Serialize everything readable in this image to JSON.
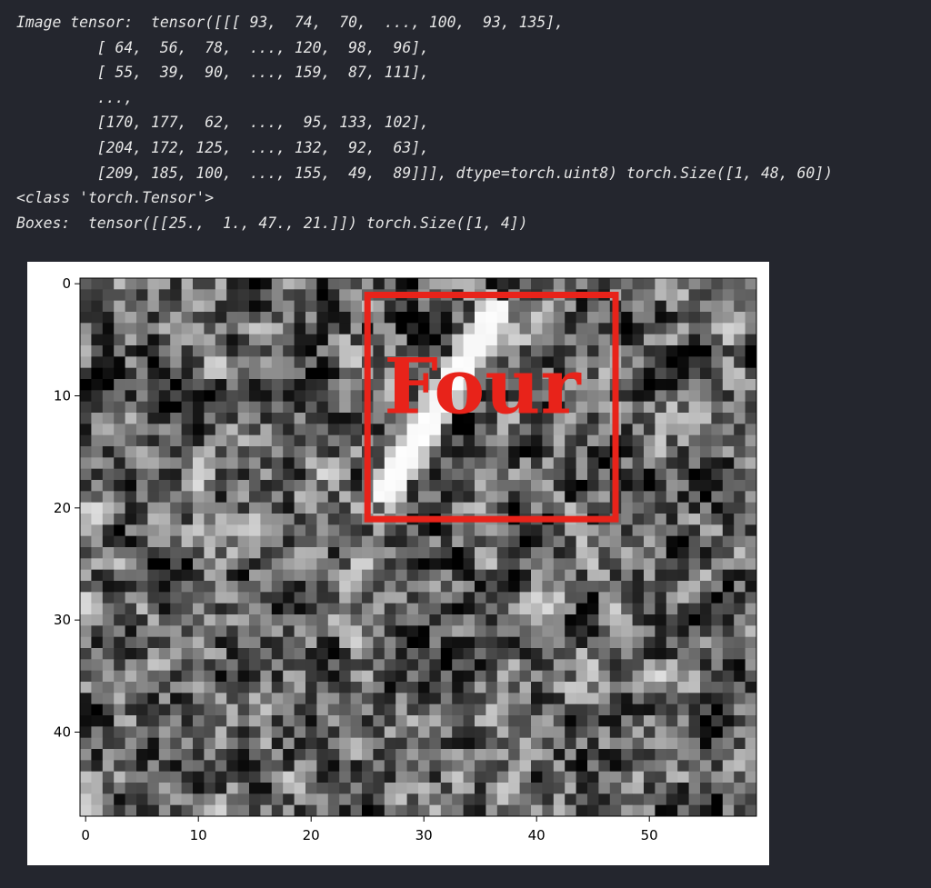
{
  "console": {
    "lines": [
      "Image tensor:  tensor([[[ 93,  74,  70,  ..., 100,  93, 135],",
      "         [ 64,  56,  78,  ..., 120,  98,  96],",
      "         [ 55,  39,  90,  ..., 159,  87, 111],",
      "         ...,",
      "         [170, 177,  62,  ...,  95, 133, 102],",
      "         [204, 172, 125,  ..., 132,  92,  63],",
      "         [209, 185, 100,  ..., 155,  49,  89]]], dtype=torch.uint8) torch.Size([1, 48, 60])",
      "<class 'torch.Tensor'>",
      "Boxes:  tensor([[25.,  1., 47., 21.]]) torch.Size([1, 4])"
    ]
  },
  "chart_data": {
    "type": "heatmap",
    "colormap": "gray",
    "image_shape": [
      48,
      60
    ],
    "x_ticks": [
      0,
      10,
      20,
      30,
      40,
      50
    ],
    "y_ticks": [
      0,
      10,
      20,
      30,
      40
    ],
    "known_pixels": {
      "row_0_first": [
        93,
        74,
        70
      ],
      "row_0_last": [
        100,
        93,
        135
      ],
      "row_1_first": [
        64,
        56,
        78
      ],
      "row_1_last": [
        120,
        98,
        96
      ],
      "row_2_first": [
        55,
        39,
        90
      ],
      "row_2_last": [
        159,
        87,
        111
      ],
      "row_45_first": [
        170,
        177,
        62
      ],
      "row_45_last": [
        95,
        133,
        102
      ],
      "row_46_first": [
        204,
        172,
        125
      ],
      "row_46_last": [
        132,
        92,
        63
      ],
      "row_47_first": [
        209,
        185,
        100
      ],
      "row_47_last": [
        155,
        49,
        89
      ]
    },
    "stroke": {
      "description": "bright diagonal stroke from lower-left to upper-right inside box",
      "from": [
        26,
        19.5
      ],
      "to": [
        37,
        1.5
      ]
    },
    "box": {
      "xmin": 25,
      "ymin": 1,
      "xmax": 47,
      "ymax": 21,
      "color": "#e8231a",
      "label": "Four"
    }
  }
}
